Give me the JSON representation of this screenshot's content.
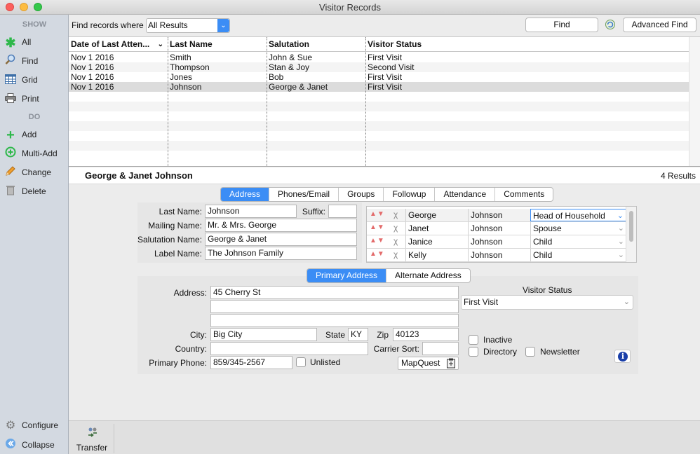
{
  "window": {
    "title": "Visitor Records"
  },
  "sidebar": {
    "show_heading": "SHOW",
    "do_heading": "DO",
    "show_items": [
      {
        "label": "All",
        "icon": "asterisk-icon"
      },
      {
        "label": "Find",
        "icon": "search-icon"
      },
      {
        "label": "Grid",
        "icon": "grid-icon"
      },
      {
        "label": "Print",
        "icon": "printer-icon"
      }
    ],
    "do_items": [
      {
        "label": "Add",
        "icon": "plus-icon"
      },
      {
        "label": "Multi-Add",
        "icon": "multi-add-icon"
      },
      {
        "label": "Change",
        "icon": "pencil-icon"
      },
      {
        "label": "Delete",
        "icon": "trash-icon"
      }
    ],
    "configure": "Configure",
    "collapse": "Collapse"
  },
  "find_bar": {
    "label": "Find records where",
    "filter_value": "All Results",
    "find_button": "Find",
    "advanced_find_button": "Advanced Find"
  },
  "grid": {
    "columns": [
      "Date of Last Atten...",
      "Last Name",
      "Salutation",
      "Visitor Status"
    ],
    "rows": [
      {
        "date": "Nov 1 2016",
        "last_name": "Smith",
        "salutation": "John & Sue",
        "status": "First Visit"
      },
      {
        "date": "Nov 1 2016",
        "last_name": "Thompson",
        "salutation": "Stan & Joy",
        "status": "Second Visit"
      },
      {
        "date": "Nov 1 2016",
        "last_name": "Jones",
        "salutation": "Bob",
        "status": "First Visit"
      },
      {
        "date": "Nov 1 2016",
        "last_name": "Johnson",
        "salutation": "George & Janet",
        "status": "First Visit"
      }
    ],
    "selected_index": 3
  },
  "record": {
    "title": "George & Janet Johnson",
    "results": "4 Results"
  },
  "tabs": [
    "Address",
    "Phones/Email",
    "Groups",
    "Followup",
    "Attendance",
    "Comments"
  ],
  "name_fields": {
    "last_name_label": "Last Name:",
    "last_name": "Johnson",
    "suffix_label": "Suffix:",
    "suffix": "",
    "mailing_label": "Mailing Name:",
    "mailing": "Mr. & Mrs. George",
    "salutation_label": "Salutation Name:",
    "salutation": "George & Janet",
    "label_label": "Label Name:",
    "label": "The Johnson Family"
  },
  "family": [
    {
      "first": "George",
      "last": "Johnson",
      "role": "Head of Household"
    },
    {
      "first": "Janet",
      "last": "Johnson",
      "role": "Spouse"
    },
    {
      "first": "Janice",
      "last": "Johnson",
      "role": "Child"
    },
    {
      "first": "Kelly",
      "last": "Johnson",
      "role": "Child"
    }
  ],
  "address_tabs": [
    "Primary Address",
    "Alternate Address"
  ],
  "address": {
    "address_label": "Address:",
    "line1": "45 Cherry St",
    "line2": "",
    "line3": "",
    "city_label": "City:",
    "city": "Big City",
    "state_label": "State",
    "state": "KY",
    "zip_label": "Zip",
    "zip": "40123",
    "country_label": "Country:",
    "country": "",
    "carrier_label": "Carrier Sort:",
    "carrier": "",
    "phone_label": "Primary Phone:",
    "phone": "859/345-2567",
    "unlisted_label": "Unlisted",
    "mapquest": "MapQuest"
  },
  "visitor_status": {
    "label": "Visitor Status",
    "value": "First Visit",
    "inactive": "Inactive",
    "directory": "Directory",
    "newsletter": "Newsletter"
  },
  "bottom": {
    "transfer": "Transfer"
  },
  "colors": {
    "accent": "#3b8df5",
    "sidebar_bg": "#d3d9e1",
    "selected_row": "#dcdcdc"
  }
}
